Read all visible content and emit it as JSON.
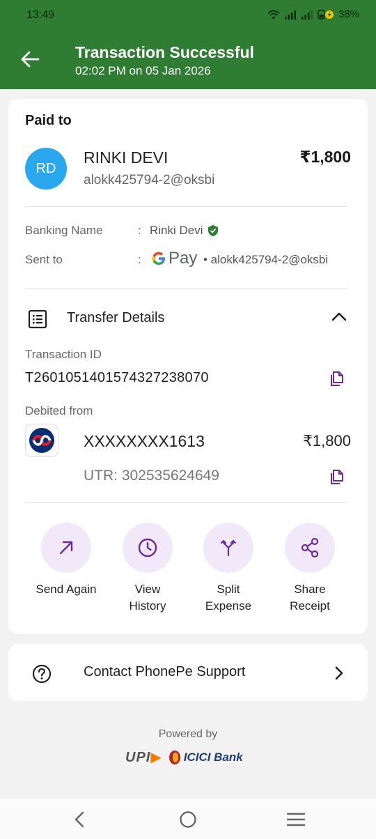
{
  "status_bar": {
    "time": "13:49",
    "battery": "38%"
  },
  "header": {
    "title": "Transaction Successful",
    "subtitle": "02:02 PM on 05 Jan 2026"
  },
  "paid_to": {
    "label": "Paid to",
    "initials": "RD",
    "name": "RINKI DEVI",
    "upi": "alokk425794-2@oksbi",
    "amount": "₹1,800"
  },
  "details": {
    "banking_name_label": "Banking Name",
    "banking_name_value": "Rinki Devi",
    "sent_to_label": "Sent to",
    "colon": ":",
    "sent_to_app": "Pay",
    "sent_to_upi": "• alokk425794-2@oksbi"
  },
  "transfer": {
    "title": "Transfer Details",
    "txn_id_label": "Transaction ID",
    "txn_id": "T2601051401574327238070",
    "debited_from_label": "Debited from",
    "account": "XXXXXXXX1613",
    "amount": "₹1,800",
    "utr": "UTR: 302535624649"
  },
  "actions": [
    {
      "label": "Send Again",
      "icon": "arrow-up-right-icon"
    },
    {
      "label": "View\nHistory",
      "icon": "clock-icon"
    },
    {
      "label": "Split\nExpense",
      "icon": "split-icon"
    },
    {
      "label": "Share\nReceipt",
      "icon": "share-icon"
    }
  ],
  "support": {
    "label": "Contact PhonePe Support"
  },
  "footer": {
    "powered_by": "Powered by",
    "upi": "UPI",
    "bank": "ICICI Bank"
  },
  "colors": {
    "header_bg": "#2e7d32",
    "accent_purple": "#6a2b9c",
    "action_bg": "#f1e8f9",
    "avatar_bg": "#29a8f0"
  }
}
